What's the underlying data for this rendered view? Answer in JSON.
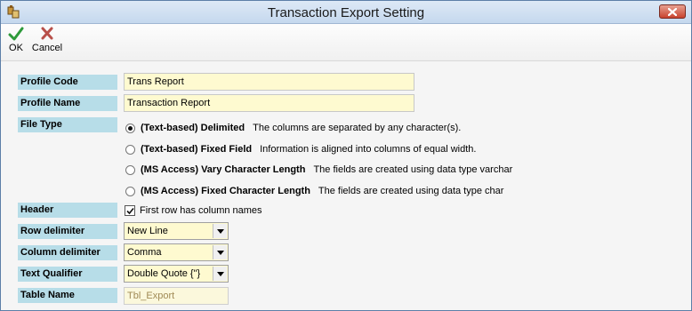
{
  "window": {
    "title": "Transaction Export Setting"
  },
  "toolbar": {
    "ok_label": "OK",
    "cancel_label": "Cancel"
  },
  "form": {
    "profile_code": {
      "label": "Profile Code",
      "value": "Trans Report"
    },
    "profile_name": {
      "label": "Profile Name",
      "value": "Transaction Report"
    },
    "file_type": {
      "label": "File Type",
      "selected_index": 0,
      "options": [
        {
          "title": "(Text-based) Delimited",
          "desc": "The columns are separated by any character(s)."
        },
        {
          "title": "(Text-based) Fixed Field",
          "desc": "Information is aligned into columns of equal width."
        },
        {
          "title": "(MS Access) Vary Character Length",
          "desc": "The fields are created using data type varchar"
        },
        {
          "title": "(MS Access) Fixed Character Length",
          "desc": "The fields are created using data type char"
        }
      ]
    },
    "header": {
      "label": "Header",
      "checkbox_label": "First row has column names",
      "checked": true
    },
    "row_delimiter": {
      "label": "Row delimiter",
      "value": "New Line"
    },
    "column_delimiter": {
      "label": "Column delimiter",
      "value": "Comma"
    },
    "text_qualifier": {
      "label": "Text Qualifier",
      "value": "Double Quote {\"}"
    },
    "table_name": {
      "label": "Table Name",
      "value": "Tbl_Export"
    }
  }
}
